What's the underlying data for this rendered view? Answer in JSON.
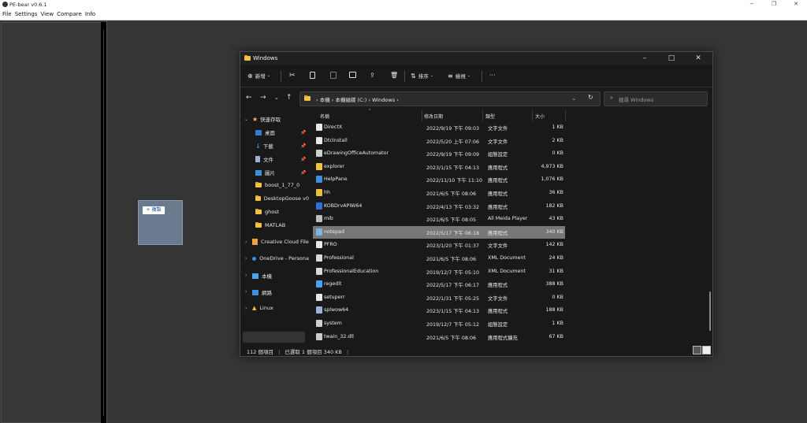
{
  "app": {
    "title": "PE-bear v0.6.1",
    "menu": [
      "File",
      "Settings",
      "View",
      "Compare",
      "Info"
    ],
    "window_controls": [
      "−",
      "❐",
      "✕"
    ]
  },
  "drag_badge": "+ 複製",
  "explorer": {
    "title": "Windows",
    "toolbar": {
      "new_label": "新增",
      "sort_label": "排序",
      "view_label": "檢視",
      "more_label": "···"
    },
    "breadcrumb": [
      "本機",
      "本機磁碟 (C:)",
      "Windows"
    ],
    "search_placeholder": "搜尋 Windows",
    "nav": {
      "quick_access": "快速存取",
      "desktop": "桌面",
      "downloads": "下載",
      "documents": "文件",
      "pictures": "圖片",
      "boost": "boost_1_77_0",
      "desktopgoose": "DesktopGoose v0",
      "ghost": "ghost",
      "matlab": "MATLAB",
      "creative_cloud": "Creative Cloud File",
      "onedrive": "OneDrive - Persona",
      "this_pc": "本機",
      "network": "網路",
      "linux": "Linux"
    },
    "columns": {
      "name": "名稱",
      "date": "修改日期",
      "type": "類型",
      "size": "大小"
    },
    "rows": [
      {
        "name": "DirectX",
        "date": "2022/9/19 下午 09:03",
        "type": "文字文件",
        "size": "1 KB",
        "icon": "text-file-icon"
      },
      {
        "name": "DtcInstall",
        "date": "2022/5/20 上午 07:06",
        "type": "文字文件",
        "size": "2 KB",
        "icon": "text-file-icon"
      },
      {
        "name": "eDrawingOfficeAutomator",
        "date": "2022/9/19 下午 09:09",
        "type": "組態設定",
        "size": "0 KB",
        "icon": "config-file-icon"
      },
      {
        "name": "explorer",
        "date": "2023/1/15 下午 04:13",
        "type": "應用程式",
        "size": "4,973 KB",
        "icon": "explorer-icon"
      },
      {
        "name": "HelpPane",
        "date": "2022/11/10 下午 11:10",
        "type": "應用程式",
        "size": "1,076 KB",
        "icon": "help-icon"
      },
      {
        "name": "hh",
        "date": "2021/6/5 下午 08:06",
        "type": "應用程式",
        "size": "36 KB",
        "icon": "help-app-icon"
      },
      {
        "name": "KOBDrvAPIW64",
        "date": "2022/4/13 下午 03:32",
        "type": "應用程式",
        "size": "182 KB",
        "icon": "driver-app-icon"
      },
      {
        "name": "mib",
        "date": "2021/6/5 下午 08:05",
        "type": "All Meida Player",
        "size": "43 KB",
        "icon": "media-file-icon"
      },
      {
        "name": "notepad",
        "date": "2022/5/17 下午 06:18",
        "type": "應用程式",
        "size": "340 KB",
        "icon": "notepad-icon",
        "selected": true
      },
      {
        "name": "PFRO",
        "date": "2023/1/20 下午 01:37",
        "type": "文字文件",
        "size": "142 KB",
        "icon": "text-file-icon"
      },
      {
        "name": "Professional",
        "date": "2021/6/5 下午 08:06",
        "type": "XML Document",
        "size": "24 KB",
        "icon": "xml-file-icon"
      },
      {
        "name": "ProfessionalEducation",
        "date": "2019/12/7 下午 05:10",
        "type": "XML Document",
        "size": "31 KB",
        "icon": "xml-file-icon"
      },
      {
        "name": "regedit",
        "date": "2022/5/17 下午 06:17",
        "type": "應用程式",
        "size": "388 KB",
        "icon": "regedit-icon"
      },
      {
        "name": "setuperr",
        "date": "2022/1/31 下午 05:25",
        "type": "文字文件",
        "size": "0 KB",
        "icon": "text-file-icon"
      },
      {
        "name": "splwow64",
        "date": "2023/1/15 下午 04:13",
        "type": "應用程式",
        "size": "188 KB",
        "icon": "printer-app-icon"
      },
      {
        "name": "system",
        "date": "2019/12/7 下午 05:12",
        "type": "組態設定",
        "size": "1 KB",
        "icon": "config-file-icon"
      },
      {
        "name": "twain_32.dll",
        "date": "2021/6/5 下午 08:06",
        "type": "應用程式擴充",
        "size": "67 KB",
        "icon": "dll-file-icon"
      }
    ],
    "status": {
      "items": "112 個項目",
      "selected": "已選取 1 個項目 340 KB"
    }
  },
  "colors": {
    "folder": "#f4c242",
    "accent": "#0078d4",
    "selected_row": "#777777"
  }
}
